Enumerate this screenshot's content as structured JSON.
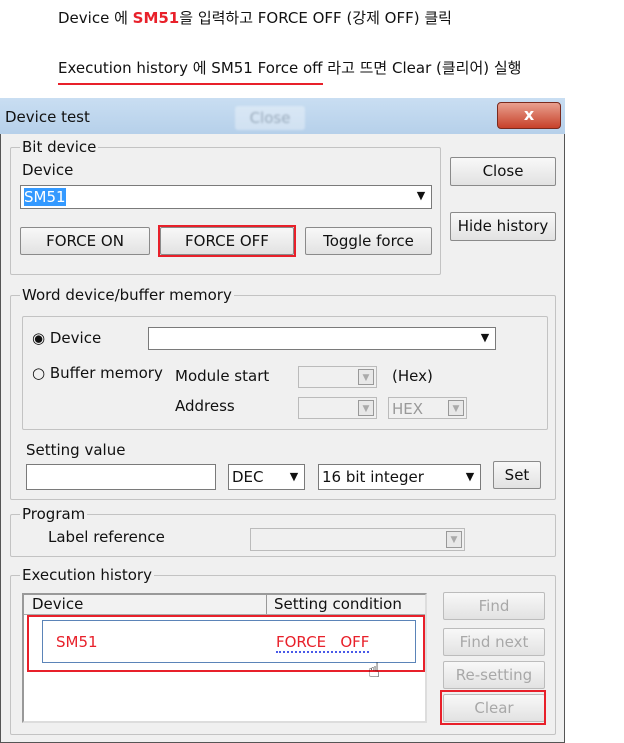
{
  "instructions": {
    "line1": {
      "prefix": "Device 에 ",
      "device": "SM51",
      "suffix": "을 입력하고 FORCE OFF (강제 OFF) 클릭"
    },
    "line2": {
      "underlined": "Execution history 에 SM51 Force off",
      "suffix": " 라고 뜨면 Clear (클리어) 실행"
    }
  },
  "window": {
    "title": "Device test",
    "ghost_title_button": "Close",
    "close_glyph": "x"
  },
  "bit_device": {
    "legend": "Bit device",
    "device_label": "Device",
    "device_value": "SM51",
    "force_on": "FORCE ON",
    "force_off": "FORCE OFF",
    "toggle_force": "Toggle force"
  },
  "side_buttons": {
    "close": "Close",
    "hide_history": "Hide history"
  },
  "word_device": {
    "legend": "Word device/buffer memory",
    "radio_device": "Device",
    "radio_buffer": "Buffer memory",
    "module_start": "Module start",
    "hex_label": "(Hex)",
    "address": "Address",
    "address_format": "HEX",
    "setting_value_label": "Setting value",
    "setting_value": "",
    "format": "DEC",
    "data_type": "16 bit integer",
    "set": "Set"
  },
  "program": {
    "legend": "Program",
    "label_reference": "Label reference"
  },
  "history": {
    "legend": "Execution history",
    "columns": [
      "Device",
      "Setting condition"
    ],
    "rows": [
      {
        "device": "SM51",
        "condition": "FORCE   OFF"
      }
    ],
    "find": "Find",
    "find_next": "Find next",
    "resetting": "Re-setting",
    "clear": "Clear"
  },
  "colors": {
    "highlight": "#e8202a"
  }
}
